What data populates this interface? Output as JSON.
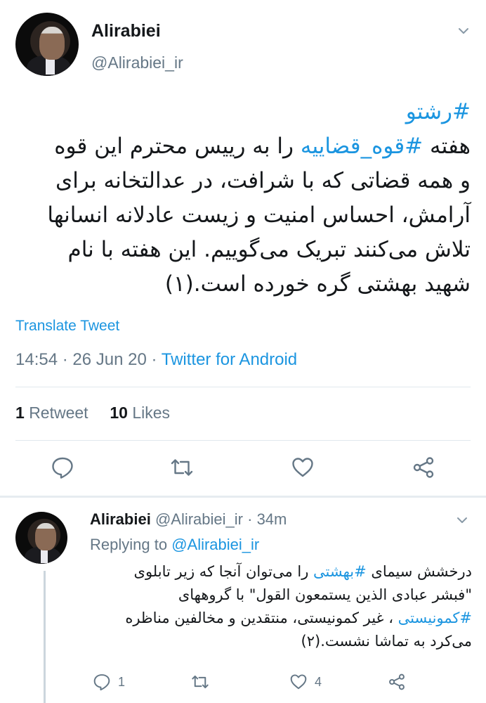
{
  "tweet": {
    "author_name": "Alirabiei",
    "author_handle": "@Alirabiei_ir",
    "hashtag_line": "#رشتو",
    "text_lines": [
      {
        "pre": "هفته ",
        "tag": "#قوه_قضاییه",
        "post": " را به رییس محترم این قوه"
      },
      {
        "text": "و همه قضاتی که با شرافت، در عدالتخانه برای"
      },
      {
        "text": "آرامش، احساس امنیت و زیست عادلانه انسانها"
      },
      {
        "text": "تلاش می‌کنند تبریک می‌گوییم. این هفته با نام"
      },
      {
        "text": "شهید بهشتی گره خورده است.(۱)"
      }
    ],
    "translate_label": "Translate Tweet",
    "time": "14:54",
    "date": "26 Jun 20",
    "source": "Twitter for Android",
    "retweet_count": "1",
    "retweet_label": "Retweet",
    "like_count": "10",
    "like_label": "Likes"
  },
  "reply": {
    "author_name": "Alirabiei",
    "author_handle": "@Alirabiei_ir",
    "time_ago": "34m",
    "replying_prefix": "Replying to",
    "replying_to": "@Alirabiei_ir",
    "lines": [
      {
        "pre": "درخشش سیمای ",
        "tag": "#بهشتی",
        "post": " را می‌توان آنجا که زیر تابلوی"
      },
      {
        "text": "\"فبشر عبادی الذین یستمعون القول\" با گروههای"
      },
      {
        "tag": "#کمونیستی",
        "post": " ، غیر کمونیستی، منتقدین و مخالفین مناظره"
      },
      {
        "text": "می‌کرد به تماشا نشست.(۲)"
      }
    ],
    "reply_count": "1",
    "like_count": "4"
  },
  "icons": [
    "chevron-down-icon",
    "reply-icon",
    "retweet-icon",
    "like-icon",
    "share-icon"
  ],
  "colors": {
    "link": "#1b95e0",
    "muted": "#657786",
    "text": "#14171a",
    "divider": "#e1e8ed"
  }
}
